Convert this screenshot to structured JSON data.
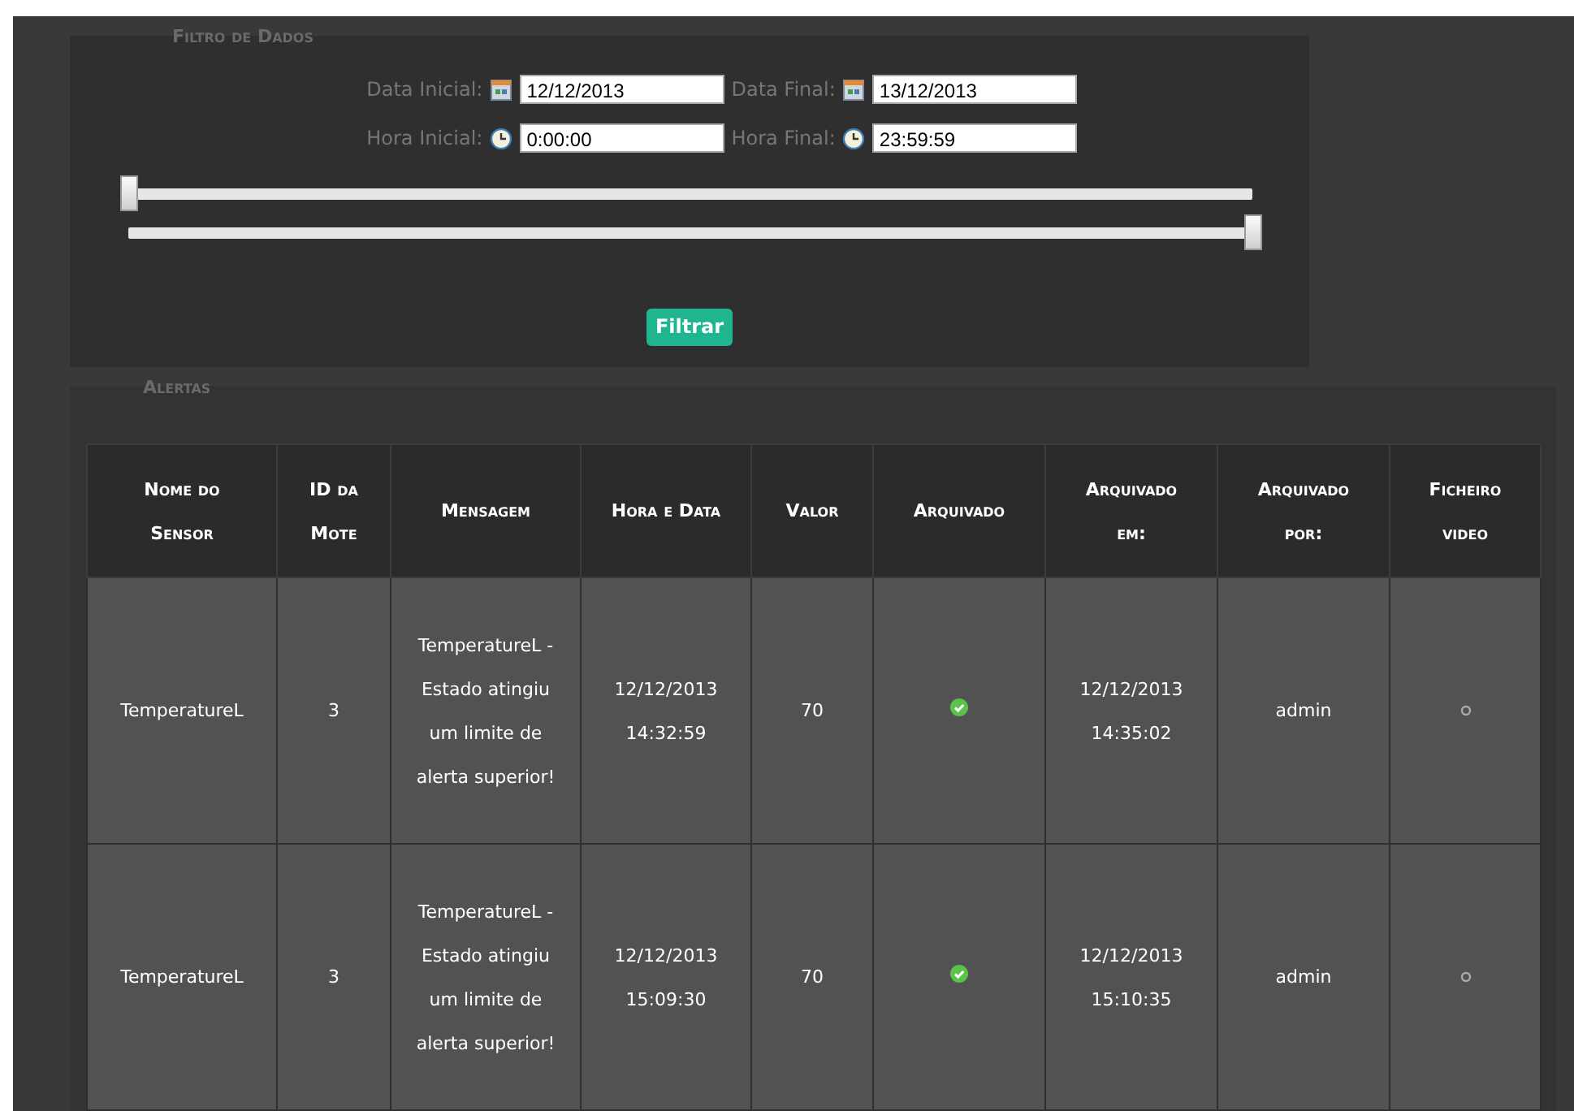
{
  "filter": {
    "title": "Filtro de Dados",
    "fields": [
      {
        "kind": "date",
        "label": "Data Inicial:",
        "value": "12/12/2013"
      },
      {
        "kind": "date",
        "label": "Data Final:",
        "value": "13/12/2013"
      },
      {
        "kind": "time",
        "label": "Hora Inicial:",
        "value": "0:00:00"
      },
      {
        "kind": "time",
        "label": "Hora Final:",
        "value": "23:59:59"
      }
    ],
    "sliders": [
      {
        "level": 0
      },
      {
        "level": 1
      }
    ],
    "button": "Filtrar"
  },
  "alerts": {
    "title": "Alertas",
    "columns": [
      "Nome do Sensor",
      "ID da Mote",
      "Mensagem",
      "Hora e Data",
      "Valor",
      "Arquivado",
      "Arquivado em:",
      "Arquivado por:",
      "Ficheiro video"
    ],
    "rows": [
      {
        "sensor": "TemperatureL",
        "mote_id": "3",
        "message": "TemperatureL - Estado atingiu um limite de alerta superior!",
        "datetime": "12/12/2013 14:32:59",
        "value": "70",
        "archived": true,
        "archived_at": "12/12/2013 14:35:02",
        "archived_by": "admin"
      },
      {
        "sensor": "TemperatureL",
        "mote_id": "3",
        "message": "TemperatureL - Estado atingiu um limite de alerta superior!",
        "datetime": "12/12/2013 15:09:30",
        "value": "70",
        "archived": true,
        "archived_at": "12/12/2013 15:10:35",
        "archived_by": "admin"
      }
    ]
  }
}
